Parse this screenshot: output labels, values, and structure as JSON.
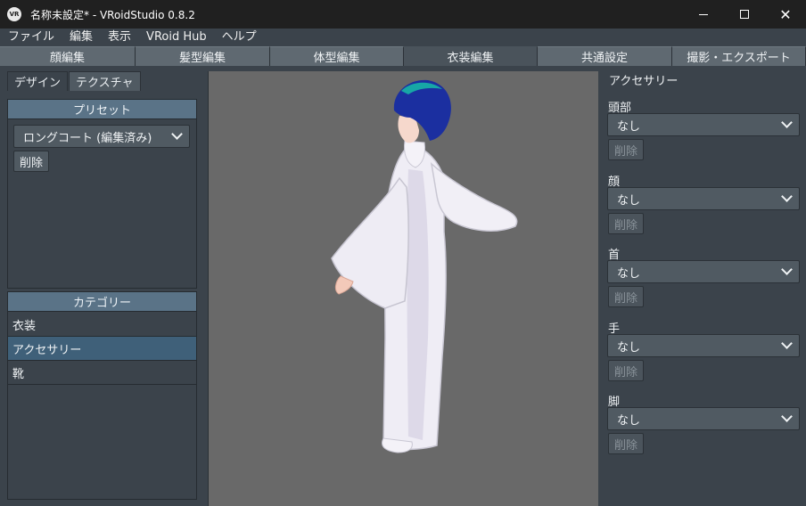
{
  "window": {
    "title": "名称未設定* - VRoidStudio 0.8.2",
    "icon_text": "VR",
    "controls": [
      "minimize",
      "maximize",
      "close"
    ]
  },
  "menu": [
    "ファイル",
    "編集",
    "表示",
    "VRoid Hub",
    "ヘルプ"
  ],
  "editor_tabs": [
    {
      "label": "顔編集",
      "active": false
    },
    {
      "label": "髪型編集",
      "active": false
    },
    {
      "label": "体型編集",
      "active": false
    },
    {
      "label": "衣装編集",
      "active": true
    },
    {
      "label": "共通設定",
      "active": false
    },
    {
      "label": "撮影・エクスポート",
      "active": false
    }
  ],
  "left": {
    "sub_tabs": [
      {
        "label": "デザイン",
        "active": true
      },
      {
        "label": "テクスチャ",
        "active": false
      }
    ],
    "preset": {
      "header": "プリセット",
      "selected": "ロングコート (編集済み)",
      "delete_label": "削除"
    },
    "category": {
      "header": "カテゴリー",
      "items": [
        {
          "label": "衣装",
          "active": false
        },
        {
          "label": "アクセサリー",
          "active": true
        },
        {
          "label": "靴",
          "active": false
        }
      ]
    }
  },
  "right": {
    "title": "アクセサリー",
    "groups": [
      {
        "label": "頭部",
        "value": "なし",
        "delete_label": "削除"
      },
      {
        "label": "顔",
        "value": "なし",
        "delete_label": "削除"
      },
      {
        "label": "首",
        "value": "なし",
        "delete_label": "削除"
      },
      {
        "label": "手",
        "value": "なし",
        "delete_label": "削除"
      },
      {
        "label": "脚",
        "value": "なし",
        "delete_label": "削除"
      }
    ]
  },
  "colors": {
    "accent_header": "#5a7387",
    "active_category": "#3f6079",
    "viewport_bg": "#696969",
    "panel_bg": "#3b434b",
    "hair": "#1b2fa0",
    "coat": "#f2f0f6"
  }
}
